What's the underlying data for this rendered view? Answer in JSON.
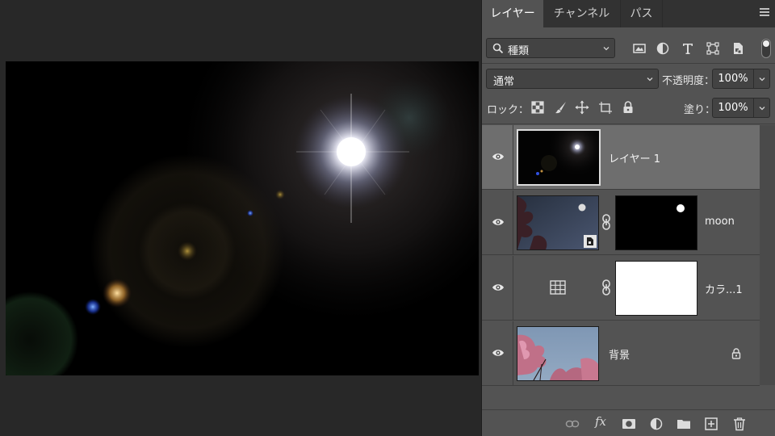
{
  "panel": {
    "tabs": [
      {
        "label": "レイヤー",
        "active": true
      },
      {
        "label": "チャンネル",
        "active": false
      },
      {
        "label": "パス",
        "active": false
      }
    ]
  },
  "filter": {
    "kind_label": "種類",
    "icons": [
      "image-filter-icon",
      "adjustment-filter-icon",
      "type-filter-icon",
      "shape-filter-icon",
      "smart-object-filter-icon"
    ]
  },
  "blend": {
    "mode": "通常",
    "opacity_label": "不透明度：",
    "opacity_value": "100%"
  },
  "lock": {
    "label": "ロック：",
    "fill_label": "塗り：",
    "fill_value": "100%"
  },
  "layers": [
    {
      "name": "レイヤー 1",
      "selected": true,
      "visible": true
    },
    {
      "name": "moon",
      "selected": false,
      "visible": true,
      "has_mask": true,
      "smart_object": true
    },
    {
      "name": "カラ...1",
      "selected": false,
      "visible": true,
      "has_mask": true,
      "adjustment": "color-lookup"
    },
    {
      "name": "背景",
      "selected": false,
      "visible": true,
      "locked": true
    }
  ],
  "bottombar": {
    "fx_label": "fx"
  },
  "colors": {
    "panel_bg": "#535353",
    "selected_layer": "#6e6e6e",
    "canvas_bg": "#282828"
  }
}
